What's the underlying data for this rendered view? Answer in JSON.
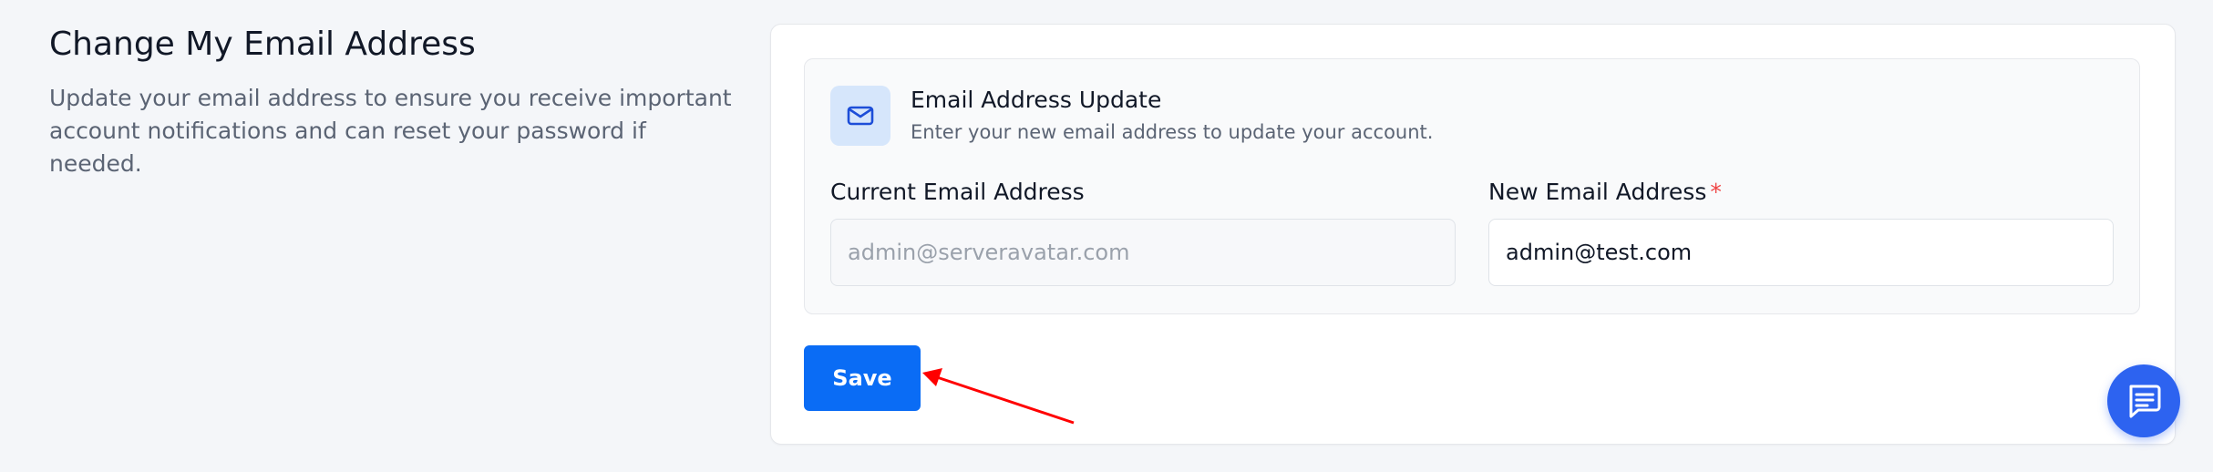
{
  "section": {
    "title": "Change My Email Address",
    "description": "Update your email address to ensure you receive important account notifications and can reset your password if needed."
  },
  "panel": {
    "icon": "mail-icon",
    "title": "Email Address Update",
    "subtitle": "Enter your new email address to update your account."
  },
  "fields": {
    "current_email": {
      "label": "Current Email Address",
      "value": "admin@serveravatar.com"
    },
    "new_email": {
      "label": "New Email Address",
      "required_marker": "*",
      "value": "admin@test.com"
    }
  },
  "actions": {
    "save_label": "Save"
  },
  "annotation": {
    "type": "arrow",
    "color": "#ff0000",
    "target": "save-button"
  },
  "widgets": {
    "chat_icon": "chat-icon",
    "chat_color": "#2d63f0"
  },
  "colors": {
    "primary": "#0a6cf5",
    "required": "#ef4444",
    "icon_bg": "#d6e6fb"
  }
}
